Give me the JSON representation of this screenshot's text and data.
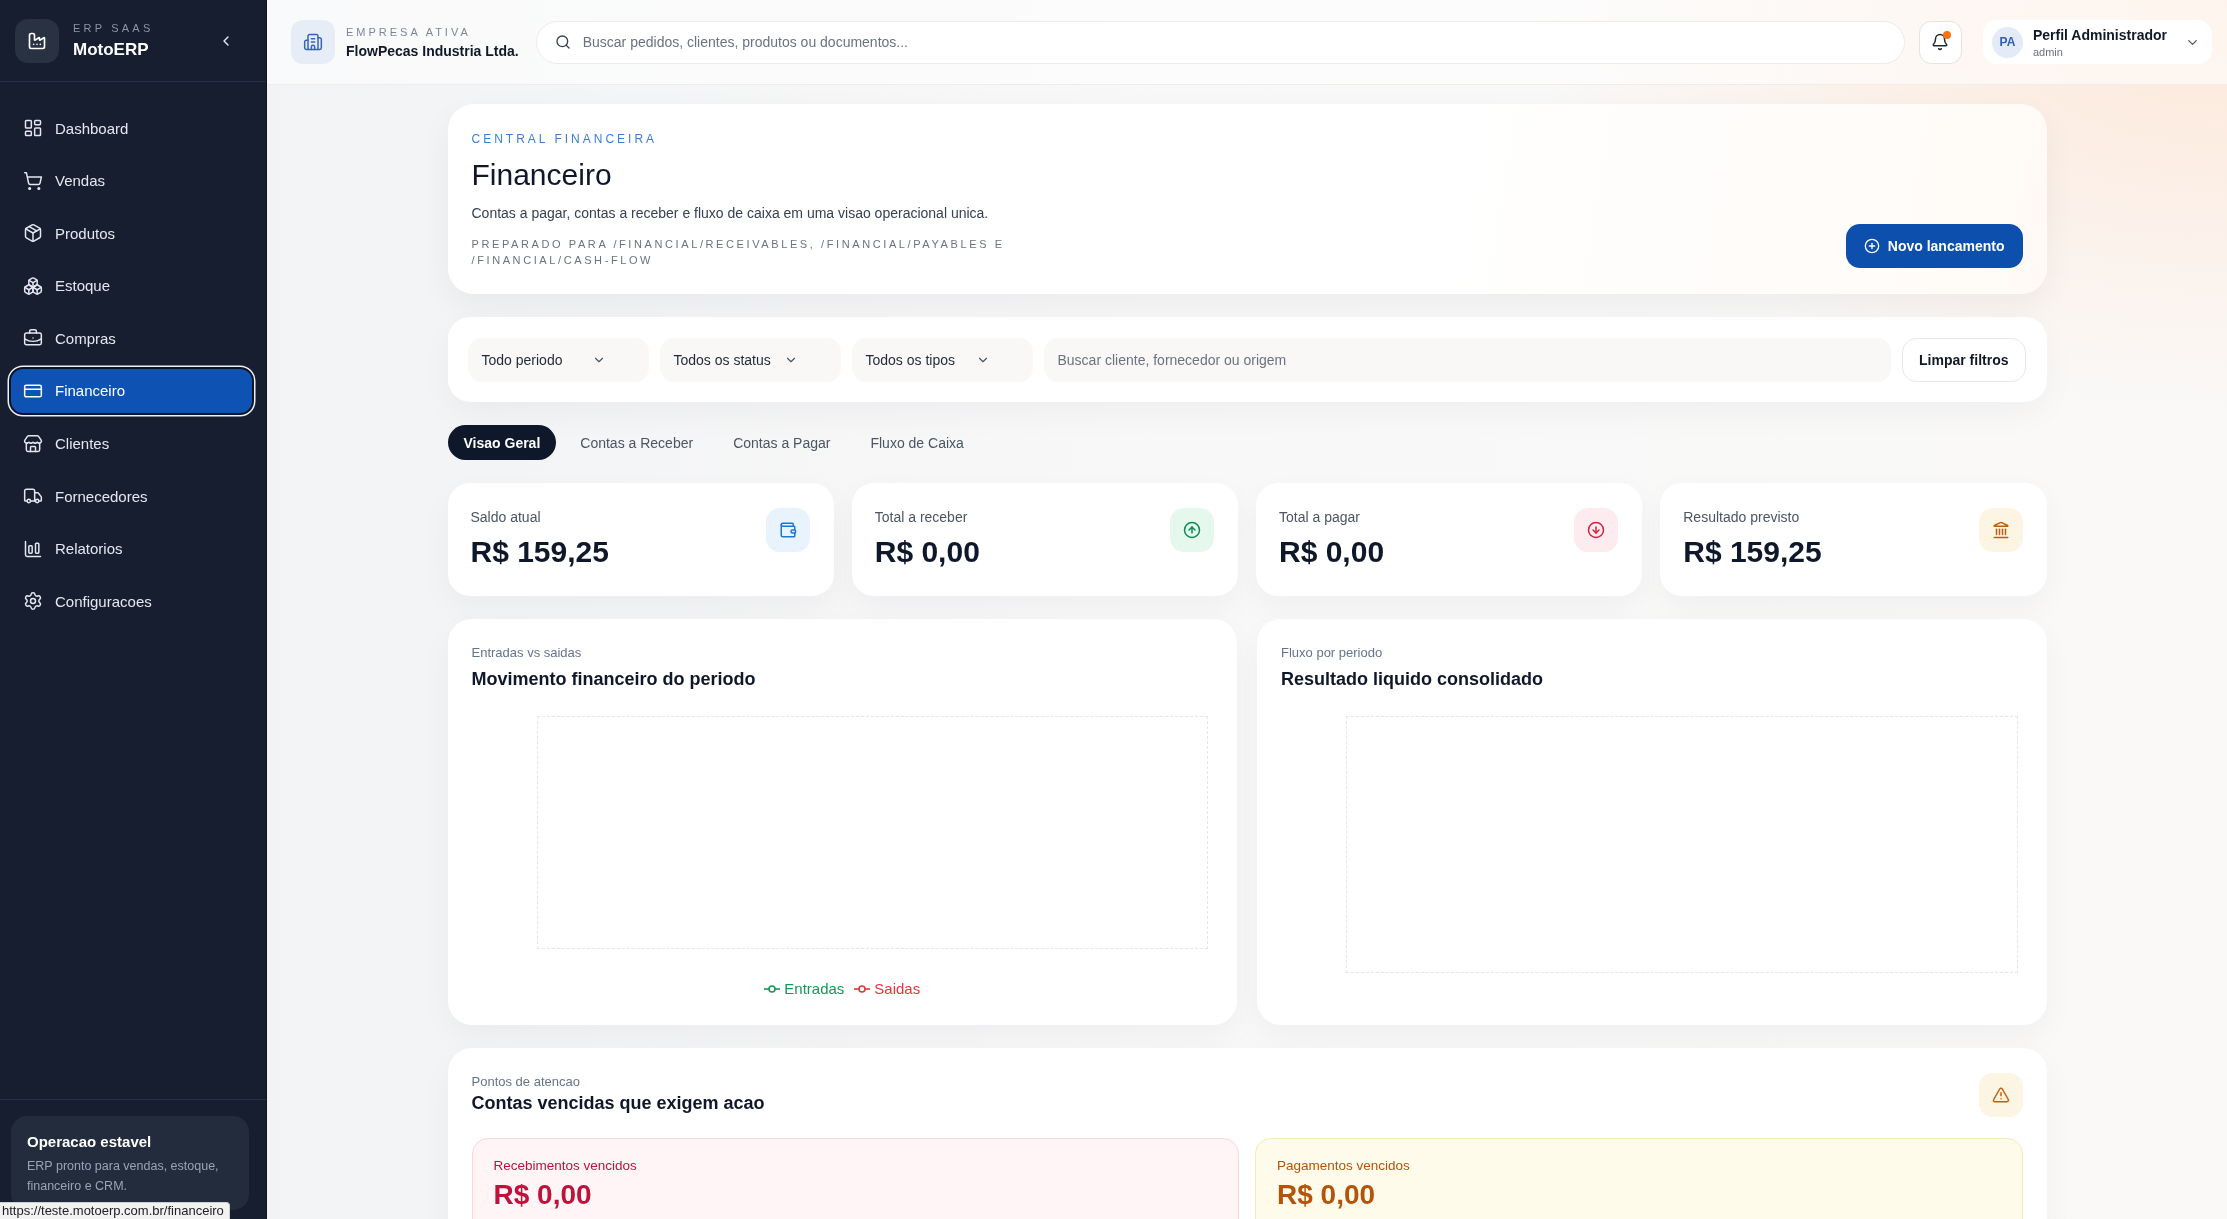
{
  "sidebar": {
    "brand": {
      "tagline": "ERP SAAS",
      "name": "MotoERP"
    },
    "nav": [
      {
        "label": "Dashboard",
        "selected": false
      },
      {
        "label": "Vendas",
        "selected": false
      },
      {
        "label": "Produtos",
        "selected": false
      },
      {
        "label": "Estoque",
        "selected": false
      },
      {
        "label": "Compras",
        "selected": false
      },
      {
        "label": "Financeiro",
        "selected": true
      },
      {
        "label": "Clientes",
        "selected": false
      },
      {
        "label": "Fornecedores",
        "selected": false
      },
      {
        "label": "Relatorios",
        "selected": false
      },
      {
        "label": "Configuracoes",
        "selected": false
      }
    ],
    "status_card": {
      "title": "Operacao estavel",
      "text": "ERP pronto para vendas, estoque, financeiro e CRM."
    }
  },
  "topbar": {
    "company": {
      "label": "EMPRESA ATIVA",
      "name": "FlowPecas Industria Ltda."
    },
    "search": {
      "placeholder": "Buscar pedidos, clientes, produtos ou documentos..."
    },
    "notifications": {
      "unread": true
    },
    "profile": {
      "initials": "PA",
      "name": "Perfil Administrador",
      "role": "admin"
    }
  },
  "hero": {
    "eyebrow": "CENTRAL FINANCEIRA",
    "title": "Financeiro",
    "description": "Contas a pagar, contas a receber e fluxo de caixa em uma visao operacional unica.",
    "note": "PREPARADO PARA /FINANCIAL/RECEIVABLES, /FINANCIAL/PAYABLES E /FINANCIAL/CASH-FLOW",
    "action": "Novo lancamento"
  },
  "filters": {
    "selects": [
      {
        "value": "Todo periodo"
      },
      {
        "value": "Todos os status"
      },
      {
        "value": "Todos os tipos"
      }
    ],
    "search": {
      "placeholder": "Buscar cliente, fornecedor ou origem"
    },
    "clear": "Limpar filtros"
  },
  "tabs": [
    {
      "label": "Visao Geral",
      "selected": true
    },
    {
      "label": "Contas a Receber",
      "selected": false
    },
    {
      "label": "Contas a Pagar",
      "selected": false
    },
    {
      "label": "Fluxo de Caixa",
      "selected": false
    }
  ],
  "stats": [
    {
      "kind": "balance",
      "label": "Saldo atual",
      "value": "R$ 159,25"
    },
    {
      "kind": "receivable",
      "label": "Total a receber",
      "value": "R$ 0,00"
    },
    {
      "kind": "payable",
      "label": "Total a pagar",
      "value": "R$ 0,00"
    },
    {
      "kind": "forecast",
      "label": "Resultado previsto",
      "value": "R$ 159,25"
    }
  ],
  "charts": [
    {
      "eyebrow": "Entradas vs saidas",
      "title": "Movimento financeiro do periodo",
      "legend": [
        {
          "label": "Entradas",
          "color": "#12995a"
        },
        {
          "label": "Saidas",
          "color": "#e2363a"
        }
      ]
    },
    {
      "eyebrow": "Fluxo por periodo",
      "title": "Resultado liquido consolidado"
    }
  ],
  "attention": {
    "eyebrow": "Pontos de atencao",
    "title": "Contas vencidas que exigem acao",
    "cards": [
      {
        "kind": "receivable",
        "label": "Recebimentos vencidos",
        "value": "R$ 0,00"
      },
      {
        "kind": "payable",
        "label": "Pagamentos vencidos",
        "value": "R$ 0,00"
      }
    ]
  },
  "browser_status": {
    "url": "https://teste.motoerp.com.br/financeiro"
  }
}
